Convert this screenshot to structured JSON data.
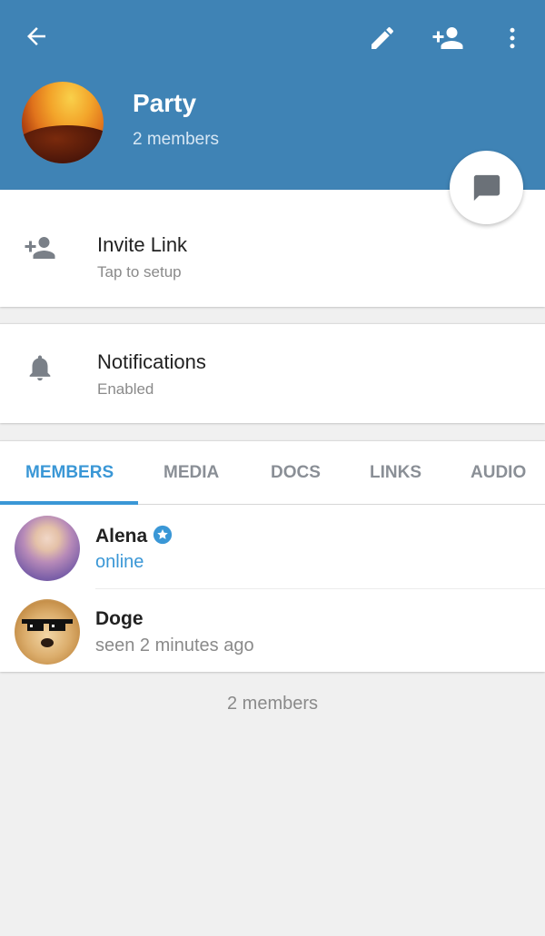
{
  "header": {
    "title": "Party",
    "subtitle": "2 members",
    "color": "#3f83b5",
    "icons": [
      "arrow-left-icon",
      "pencil-icon",
      "add-person-icon",
      "more-vertical-icon"
    ]
  },
  "fab": {
    "icon": "chat-bubble-icon"
  },
  "invite": {
    "title": "Invite Link",
    "subtitle": "Tap to setup",
    "icon": "add-person-icon"
  },
  "notifications": {
    "title": "Notifications",
    "subtitle": "Enabled",
    "icon": "bell-icon"
  },
  "tabs": [
    {
      "label": "MEMBERS",
      "active": true
    },
    {
      "label": "MEDIA",
      "active": false
    },
    {
      "label": "DOCS",
      "active": false
    },
    {
      "label": "LINKS",
      "active": false
    },
    {
      "label": "AUDIO",
      "active": false
    }
  ],
  "members": [
    {
      "name": "Alena",
      "status": "online",
      "verified": true
    },
    {
      "name": "Doge",
      "status": "seen 2 minutes ago",
      "verified": false
    }
  ],
  "footer": {
    "count": "2 members"
  },
  "colors": {
    "accent": "#3a97d6",
    "header": "#3f83b5"
  }
}
